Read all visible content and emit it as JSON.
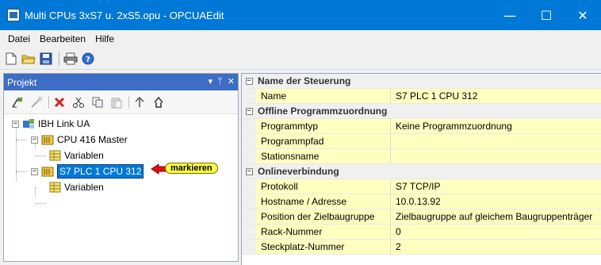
{
  "window": {
    "title": "Multi CPUs 3xS7 u. 2xS5.opu - OPCUAEdit",
    "minimize": "—",
    "maximize": "☐",
    "close": "✕"
  },
  "menu": [
    "Datei",
    "Bearbeiten",
    "Hilfe"
  ],
  "toolbar_icons": [
    "new-file-icon",
    "open-folder-icon",
    "save-icon",
    "print-icon",
    "help-icon"
  ],
  "project_panel": {
    "title": "Projekt",
    "header_controls": [
      "▾",
      "ᛘ",
      "✕"
    ],
    "toolbar_icons": [
      "add-node-icon",
      "edit-icon",
      "delete-icon",
      "cut-icon",
      "copy-icon",
      "paste-icon",
      "move-up-icon",
      "move-top-icon"
    ],
    "tree": [
      {
        "label": "IBH Link UA",
        "expander": "−"
      },
      {
        "label": "CPU 416 Master",
        "expander": "−"
      },
      {
        "label": "Variablen"
      },
      {
        "label": "S7 PLC 1 CPU 312",
        "expander": "−",
        "selected": true
      },
      {
        "label": "Variablen"
      }
    ],
    "callout": "markieren"
  },
  "properties": [
    {
      "category": "Name der Steuerung",
      "rows": [
        {
          "name": "Name",
          "value": "S7 PLC 1 CPU 312"
        }
      ]
    },
    {
      "category": "Offline Programmzuordnung",
      "rows": [
        {
          "name": "Programmtyp",
          "value": "Keine Programmzuordnung"
        },
        {
          "name": "Programmpfad",
          "value": ""
        },
        {
          "name": "Stationsname",
          "value": ""
        }
      ]
    },
    {
      "category": "Onlineverbindung",
      "rows": [
        {
          "name": "Protokoll",
          "value": "S7 TCP/IP"
        },
        {
          "name": "Hostname / Adresse",
          "value": "10.0.13.92"
        },
        {
          "name": "Position der Zielbaugruppe",
          "value": "Zielbaugruppe auf gleichem Baugruppenträger"
        },
        {
          "name": "Rack-Nummer",
          "value": "0"
        },
        {
          "name": "Steckplatz-Nummer",
          "value": "2"
        }
      ]
    }
  ],
  "colors": {
    "titlebar": "#0078d7",
    "panel_header": "#3d6dc4",
    "property_bg": "#ffffc0",
    "callout": "#ffff40",
    "arrow": "#e01010"
  }
}
